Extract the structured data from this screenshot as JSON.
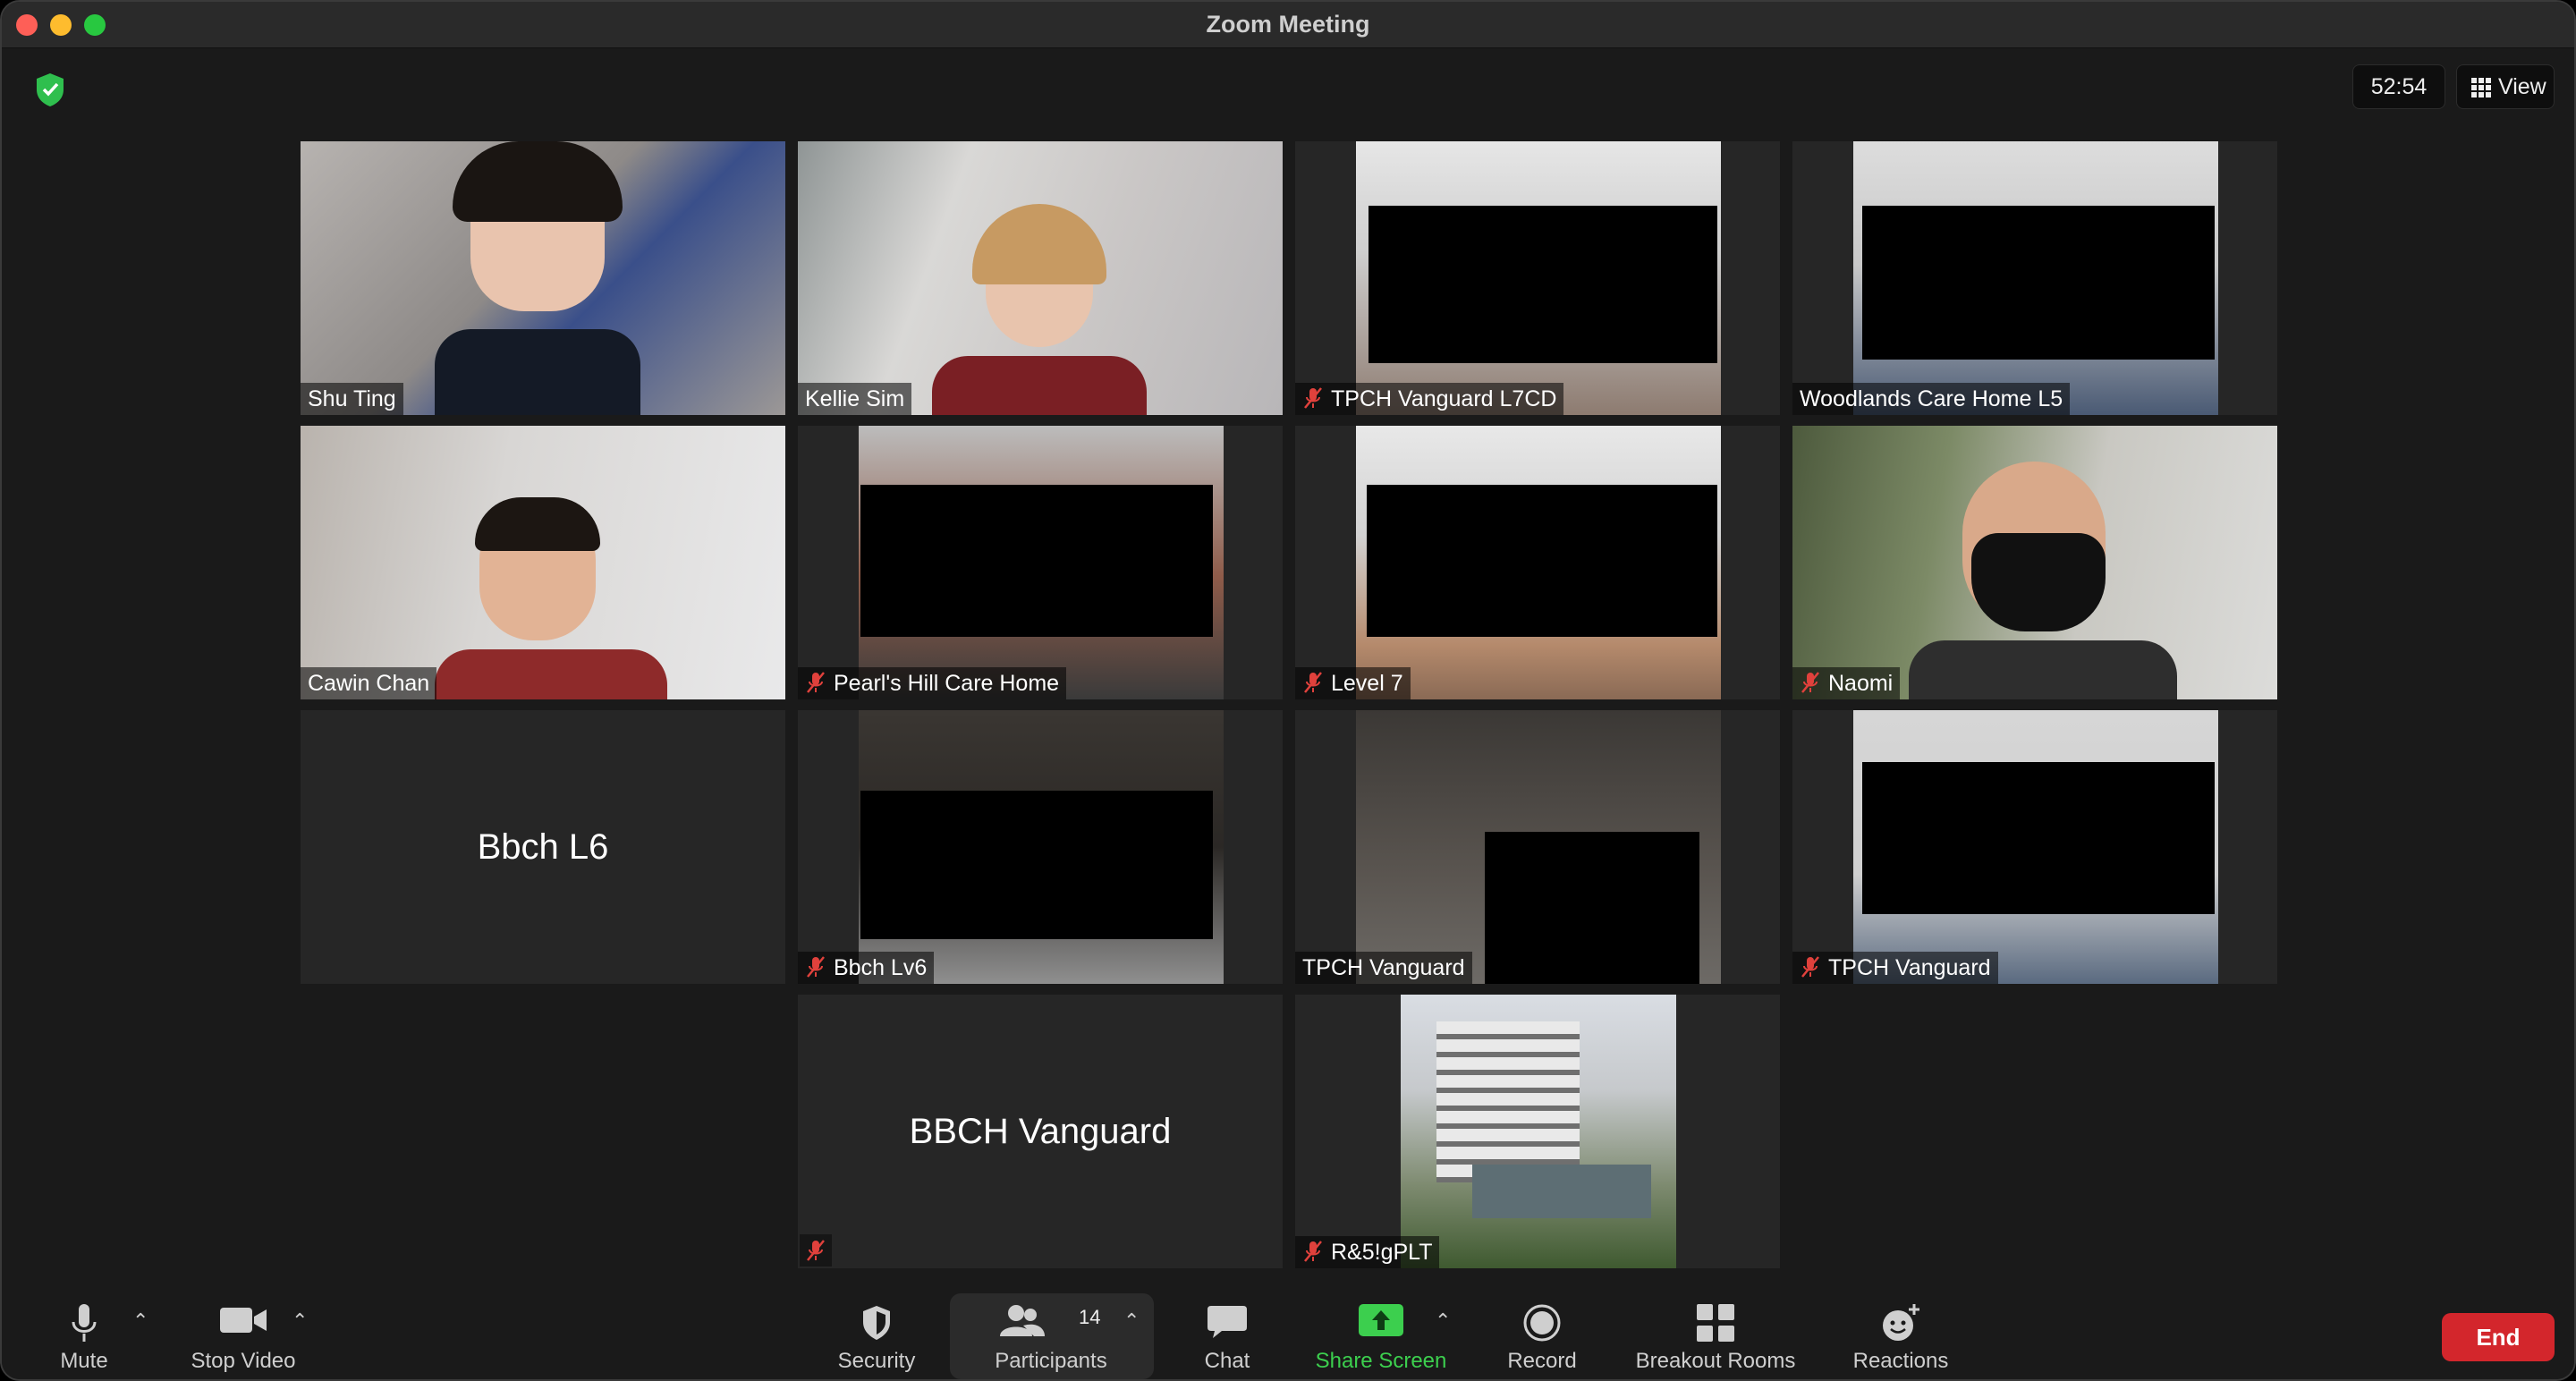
{
  "window": {
    "title": "Zoom Meeting"
  },
  "top": {
    "timer": "52:54",
    "view_label": "View"
  },
  "tiles": [
    {
      "name": "Shu Ting",
      "muted": false
    },
    {
      "name": "Kellie Sim",
      "muted": false,
      "active_speaker": true
    },
    {
      "name": "TPCH Vanguard L7CD",
      "muted": true
    },
    {
      "name": "Woodlands Care Home L5",
      "muted": false
    },
    {
      "name": "Cawin Chan",
      "muted": false
    },
    {
      "name": "Pearl's Hill Care Home",
      "muted": true
    },
    {
      "name": "Level 7",
      "muted": true
    },
    {
      "name": "Naomi",
      "muted": true
    },
    {
      "name": "Bbch L6",
      "muted": false,
      "video_off": true
    },
    {
      "name": "Bbch Lv6",
      "muted": true
    },
    {
      "name": "TPCH Vanguard",
      "muted": false
    },
    {
      "name": "TPCH Vanguard",
      "muted": true
    },
    {
      "name": "BBCH Vanguard",
      "muted": true,
      "video_off": true
    },
    {
      "name": "R&5!gPLT",
      "muted": true
    }
  ],
  "toolbar": {
    "mute": "Mute",
    "stop_video": "Stop Video",
    "security": "Security",
    "participants": "Participants",
    "participants_count": "14",
    "chat": "Chat",
    "share_screen": "Share Screen",
    "record": "Record",
    "breakout_rooms": "Breakout Rooms",
    "reactions": "Reactions",
    "end": "End"
  },
  "colors": {
    "active_speaker_border": "#e4ef9a",
    "share_green": "#3ccf4e",
    "end_red": "#d3262c",
    "muted_mic_red": "#e0413c"
  }
}
